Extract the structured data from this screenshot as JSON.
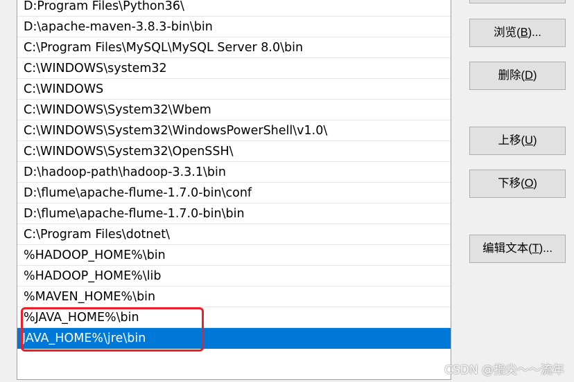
{
  "path_list": {
    "entries": [
      "D:Program Files\\Python36\\",
      "D:\\apache-maven-3.8.3-bin\\bin",
      "C:\\Program Files\\MySQL\\MySQL Server 8.0\\bin",
      "C:\\WINDOWS\\system32",
      "C:\\WINDOWS",
      "C:\\WINDOWS\\System32\\Wbem",
      "C:\\WINDOWS\\System32\\WindowsPowerShell\\v1.0\\",
      "C:\\WINDOWS\\System32\\OpenSSH\\",
      "D:\\hadoop-path\\hadoop-3.3.1\\bin",
      "D:\\flume\\apache-flume-1.7.0-bin\\conf",
      "D:\\flume\\apache-flume-1.7.0-bin\\bin",
      "C:\\Program Files\\dotnet\\",
      "%HADOOP_HOME%\\bin",
      "%HADOOP_HOME%\\lib",
      "%MAVEN_HOME%\\bin",
      "%JAVA_HOME%\\bin",
      "JAVA_HOME%\\jre\\bin"
    ],
    "selected_index": 16
  },
  "buttons": {
    "browse": {
      "text": "浏览(",
      "key": "B",
      "suffix": ")..."
    },
    "delete": {
      "text": "删除(",
      "key": "D",
      "suffix": ")"
    },
    "move_up": {
      "text": "上移(",
      "key": "U",
      "suffix": ")"
    },
    "move_down": {
      "text": "下移(",
      "key": "O",
      "suffix": ")"
    },
    "edit_text": {
      "text": "编辑文本(",
      "key": "T",
      "suffix": ")..."
    }
  },
  "colors": {
    "selection": "#0078d7",
    "highlight_box": "#e8212b"
  },
  "watermark": "CSDN @指尖～～流年"
}
